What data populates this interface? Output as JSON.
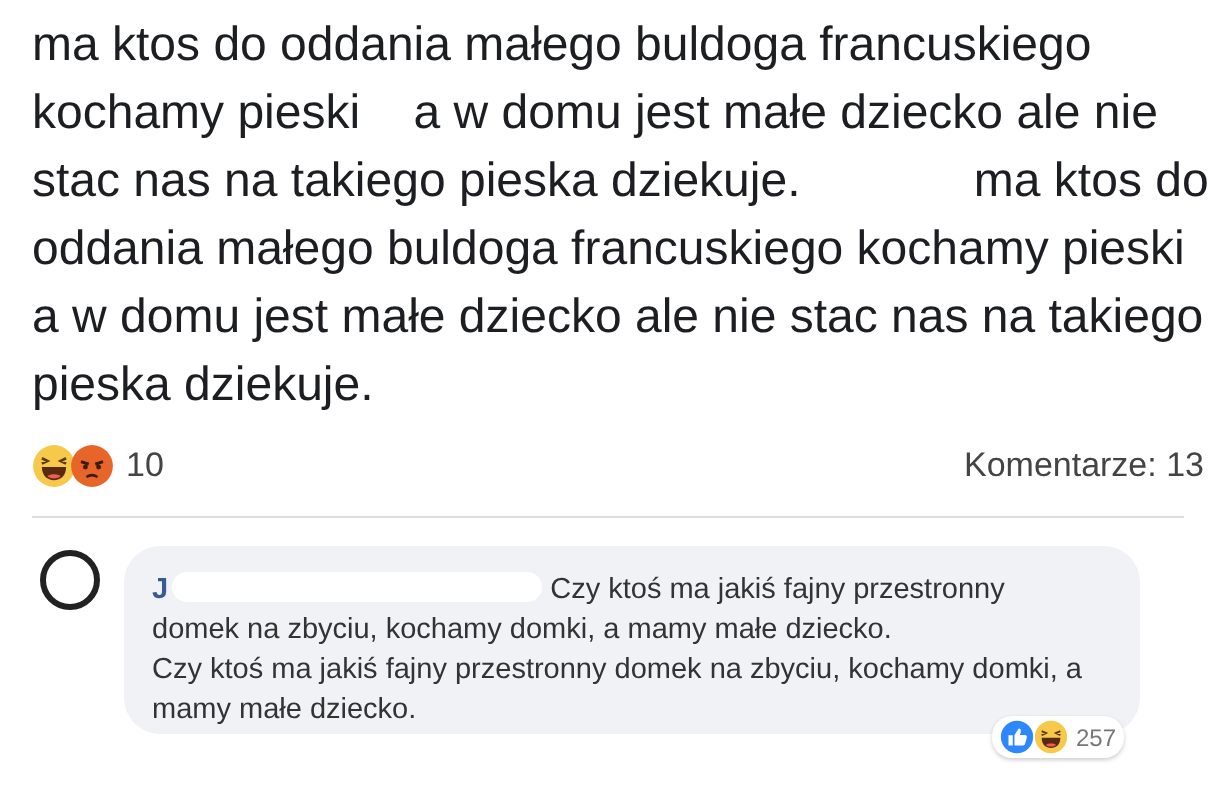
{
  "post": {
    "text": "ma ktos do oddania małego buldoga francuskiego kochamy pieski    a w domu jest małe dziecko ale nie stac nas na takiego pieska dziekuje.             ma ktos do oddania małego buldoga francuskiego kochamy pieski    a w domu jest małe dziecko ale nie stac nas na takiego pieska dziekuje.",
    "reactions": [
      {
        "kind": "haha"
      },
      {
        "kind": "angry"
      }
    ],
    "reaction_count": "10",
    "comments_label": "Komentarze: 13"
  },
  "comment": {
    "author": "J",
    "author_redacted": true,
    "text": "Czy ktoś ma jakiś fajny przestronny domek na zbyciu, kochamy domki, a mamy małe dziecko.",
    "text_2": "Czy ktoś ma jakiś fajny przestronny domek na zbyciu, kochamy domki, a mamy małe dziecko.",
    "reactions": [
      {
        "kind": "like"
      },
      {
        "kind": "haha"
      }
    ],
    "reaction_count": "257"
  }
}
